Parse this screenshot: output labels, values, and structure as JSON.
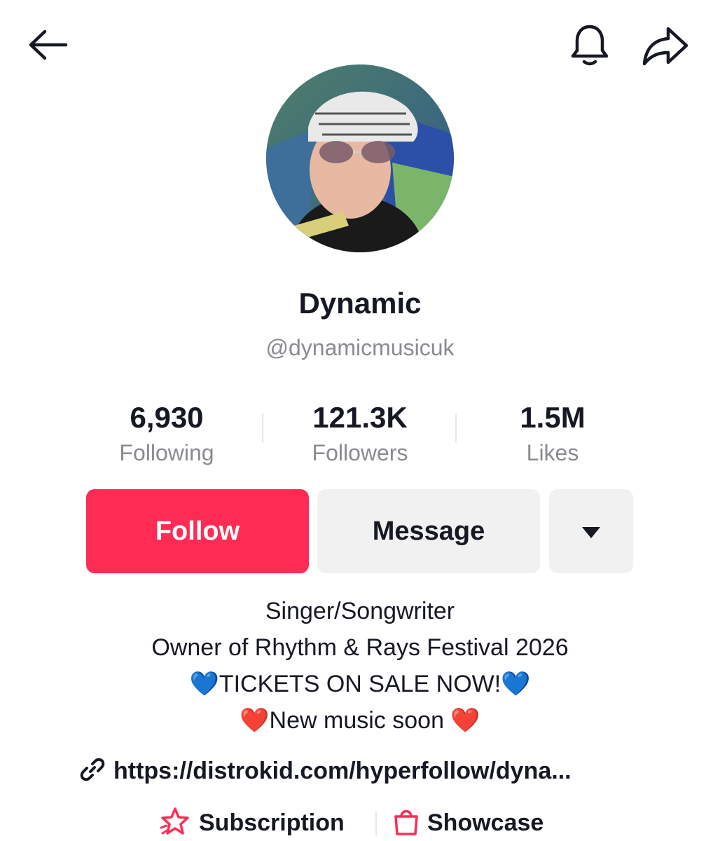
{
  "header": {
    "back_icon": "arrow-left-icon",
    "bell_icon": "bell-icon",
    "share_icon": "share-arrow-icon"
  },
  "profile": {
    "display_name": "Dynamic",
    "username": "@dynamicmusicuk"
  },
  "stats": [
    {
      "value": "6,930",
      "label": "Following"
    },
    {
      "value": "121.3K",
      "label": "Followers"
    },
    {
      "value": "1.5M",
      "label": "Likes"
    }
  ],
  "actions": {
    "follow_label": "Follow",
    "message_label": "Message",
    "more_icon": "caret-down-icon"
  },
  "bio": {
    "lines": [
      "Singer/Songwriter",
      "Owner of Rhythm & Rays Festival 2026",
      "💙TICKETS ON SALE NOW!💙",
      "❤️New music soon ❤️"
    ]
  },
  "link": {
    "icon": "link-icon",
    "text": "https://distrokid.com/hyperfollow/dyna..."
  },
  "features": {
    "subscription_label": "Subscription",
    "showcase_label": "Showcase"
  },
  "colors": {
    "follow_button": "#fe2c55",
    "secondary_button": "#f1f1f2",
    "secondary_text": "#8a8b91",
    "primary_text": "#161823"
  }
}
